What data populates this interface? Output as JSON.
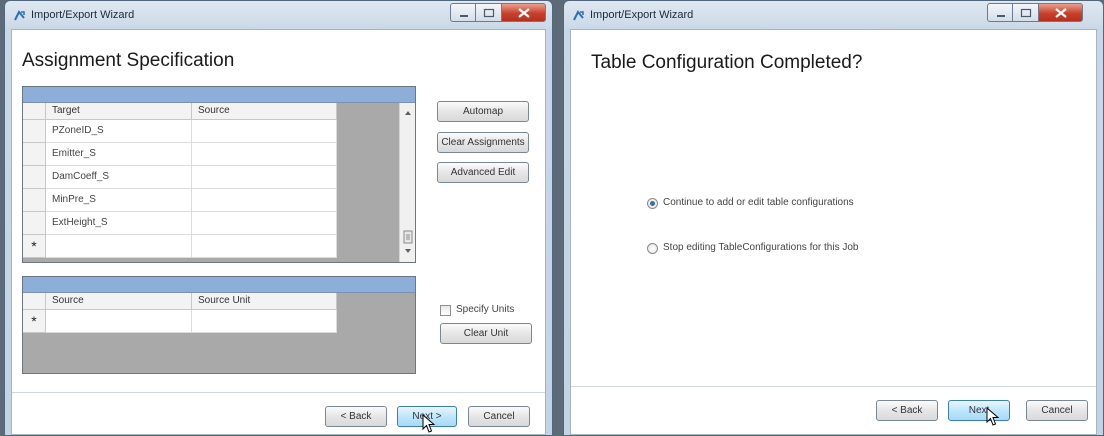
{
  "left_window": {
    "title": "Import/Export Wizard",
    "heading": "Assignment Specification",
    "assignment_grid": {
      "columns": [
        "Target",
        "Source"
      ],
      "rows": [
        {
          "target": "PZoneID_S",
          "source": ""
        },
        {
          "target": "Emitter_S",
          "source": ""
        },
        {
          "target": "DamCoeff_S",
          "source": ""
        },
        {
          "target": "MinPre_S",
          "source": ""
        },
        {
          "target": "ExtHeight_S",
          "source": ""
        }
      ],
      "new_row_marker": "*"
    },
    "side_buttons": {
      "automap": "Automap",
      "clear_assignments": "Clear Assignments",
      "advanced_edit": "Advanced Edit"
    },
    "unit_grid": {
      "columns": [
        "Source",
        "Source Unit"
      ],
      "new_row_marker": "*"
    },
    "specify_units": {
      "label": "Specify Units",
      "checked": false
    },
    "clear_unit": "Clear Unit",
    "footer": {
      "back": "< Back",
      "next": "Next >",
      "cancel": "Cancel"
    }
  },
  "right_window": {
    "title": "Import/Export Wizard",
    "heading": "Table Configuration Completed?",
    "options": [
      {
        "label": "Continue to add or edit table configurations",
        "selected": true
      },
      {
        "label": "Stop editing TableConfigurations for this Job",
        "selected": false
      }
    ],
    "footer": {
      "back": "< Back",
      "next": "Next",
      "cancel": "Cancel"
    }
  },
  "colors": {
    "grid_header": "#8daed9",
    "grid_background": "#a9a9a9",
    "close_button": "#c8412c",
    "window_frame": "#c9d7e6"
  }
}
